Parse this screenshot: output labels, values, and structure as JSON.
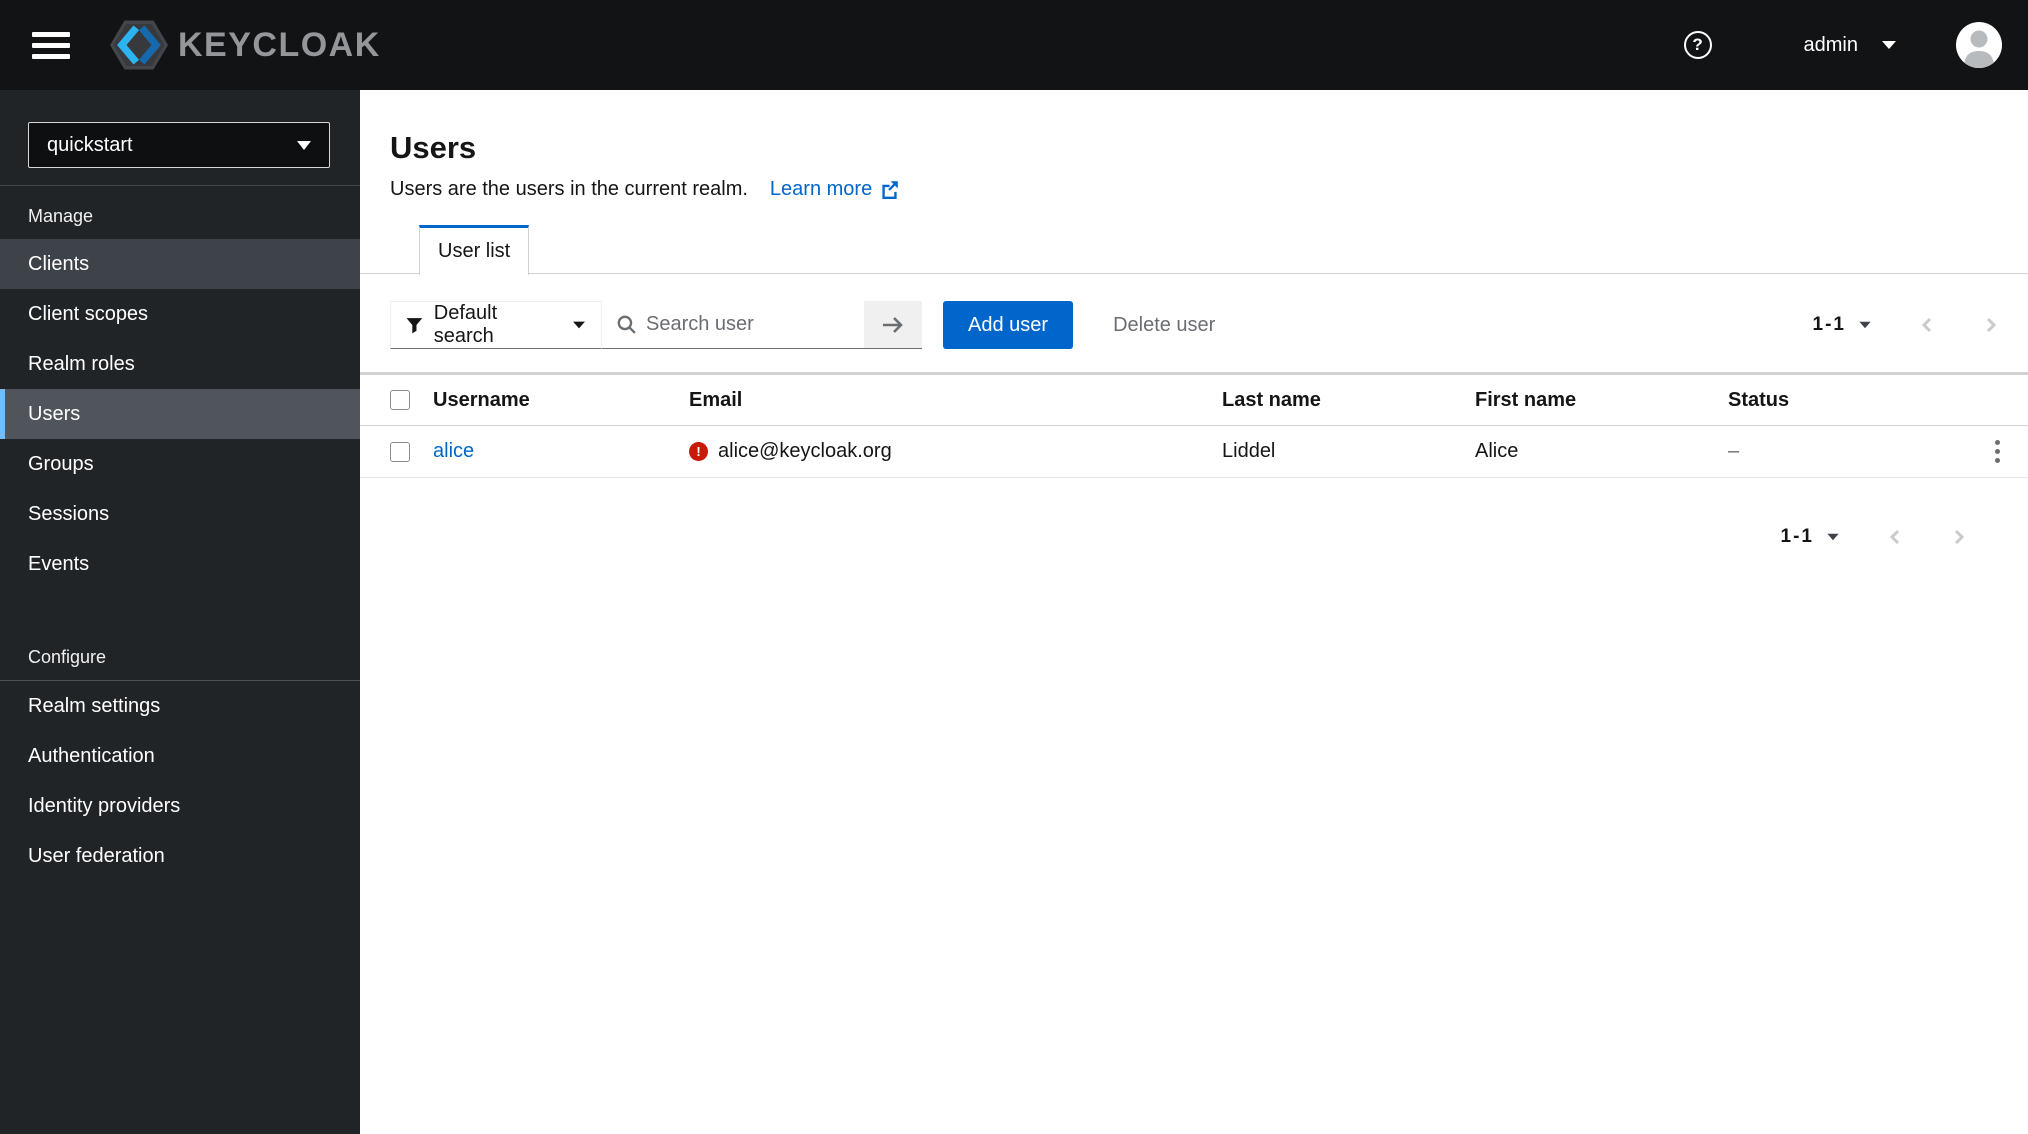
{
  "colors": {
    "accent": "#0066cc",
    "danger": "#c9190b",
    "nav_selected_bar": "#73bcf7"
  },
  "masthead": {
    "logo_text": "KEYCLOAK",
    "user_label": "admin"
  },
  "sidebar": {
    "realm_selector": {
      "value": "quickstart"
    },
    "groups": [
      {
        "title": "Manage",
        "items": [
          {
            "label": "Clients"
          },
          {
            "label": "Client scopes"
          },
          {
            "label": "Realm roles"
          },
          {
            "label": "Users"
          },
          {
            "label": "Groups"
          },
          {
            "label": "Sessions"
          },
          {
            "label": "Events"
          }
        ]
      },
      {
        "title": "Configure",
        "items": [
          {
            "label": "Realm settings"
          },
          {
            "label": "Authentication"
          },
          {
            "label": "Identity providers"
          },
          {
            "label": "User federation"
          }
        ]
      }
    ]
  },
  "page": {
    "title": "Users",
    "subtitle": "Users are the users in the current realm.",
    "learn_more_label": "Learn more",
    "tab_label": "User list"
  },
  "toolbar": {
    "filter_label": "Default search",
    "search_placeholder": "Search user",
    "add_user_label": "Add user",
    "delete_user_label": "Delete user",
    "pagination_range": "1-1"
  },
  "table": {
    "columns": [
      "Username",
      "Email",
      "Last name",
      "First name",
      "Status"
    ],
    "rows": [
      {
        "username": "alice",
        "email": "alice@keycloak.org",
        "email_warning": "!",
        "last_name": "Liddel",
        "first_name": "Alice",
        "status": "–"
      }
    ]
  },
  "footer": {
    "pagination_range": "1-1"
  }
}
